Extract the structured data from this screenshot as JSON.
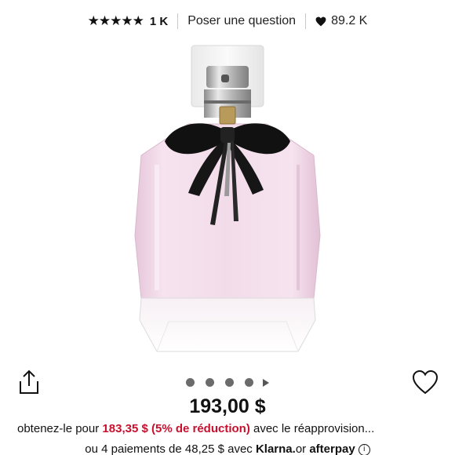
{
  "header": {
    "rating_stars": "★★★★★",
    "rating_count": "1 K",
    "ask_question": "Poser une question",
    "loves_count": "89.2 K"
  },
  "product": {
    "image_icon": "perfume-bottle-image",
    "carousel": {
      "dots": 4,
      "has_more_indicator": true
    }
  },
  "pricing": {
    "price": "193,00 $",
    "autoreplenish_prefix": "obtenez-le pour",
    "autoreplenish_sale": "183,35 $ (5% de réduction)",
    "autoreplenish_suffix": "avec le réapprovision...",
    "installments_prefix": "ou 4 paiements de 48,25 $ avec",
    "klarna": "Klarna.",
    "or_text": "or",
    "afterpay": "afterpay"
  },
  "colors": {
    "sale_red": "#c8102e",
    "text": "#111111",
    "bottle_pink": "#f2dbe8"
  }
}
